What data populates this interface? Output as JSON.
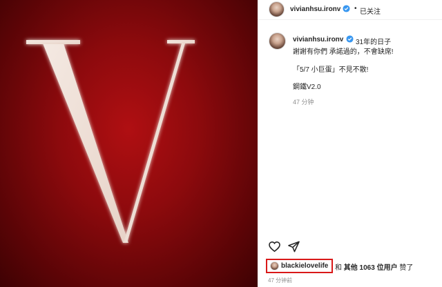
{
  "post": {
    "image_letter": "V",
    "accent_color": "#8d0a0d"
  },
  "header": {
    "username": "vivianhsu.ironv",
    "separator": "•",
    "follow_status": "已关注"
  },
  "caption": {
    "username": "vivianhsu.ironv",
    "line1": "31年的日子",
    "line2": "謝謝有你們 承諾過的，不會缺席!",
    "line3": "「5/7 小巨蛋」不見不散!",
    "line4": "鋼鐵V2.0",
    "time": "47 分钟"
  },
  "actions": {
    "like_icon": "heart-icon",
    "share_icon": "paper-plane-icon"
  },
  "likes": {
    "liker": "blackielovelife",
    "joiner": "和",
    "others_label": "其他 1063 位用户",
    "suffix": "赞了",
    "highlight_color": "#d91818"
  },
  "post_time": "47 分钟前"
}
